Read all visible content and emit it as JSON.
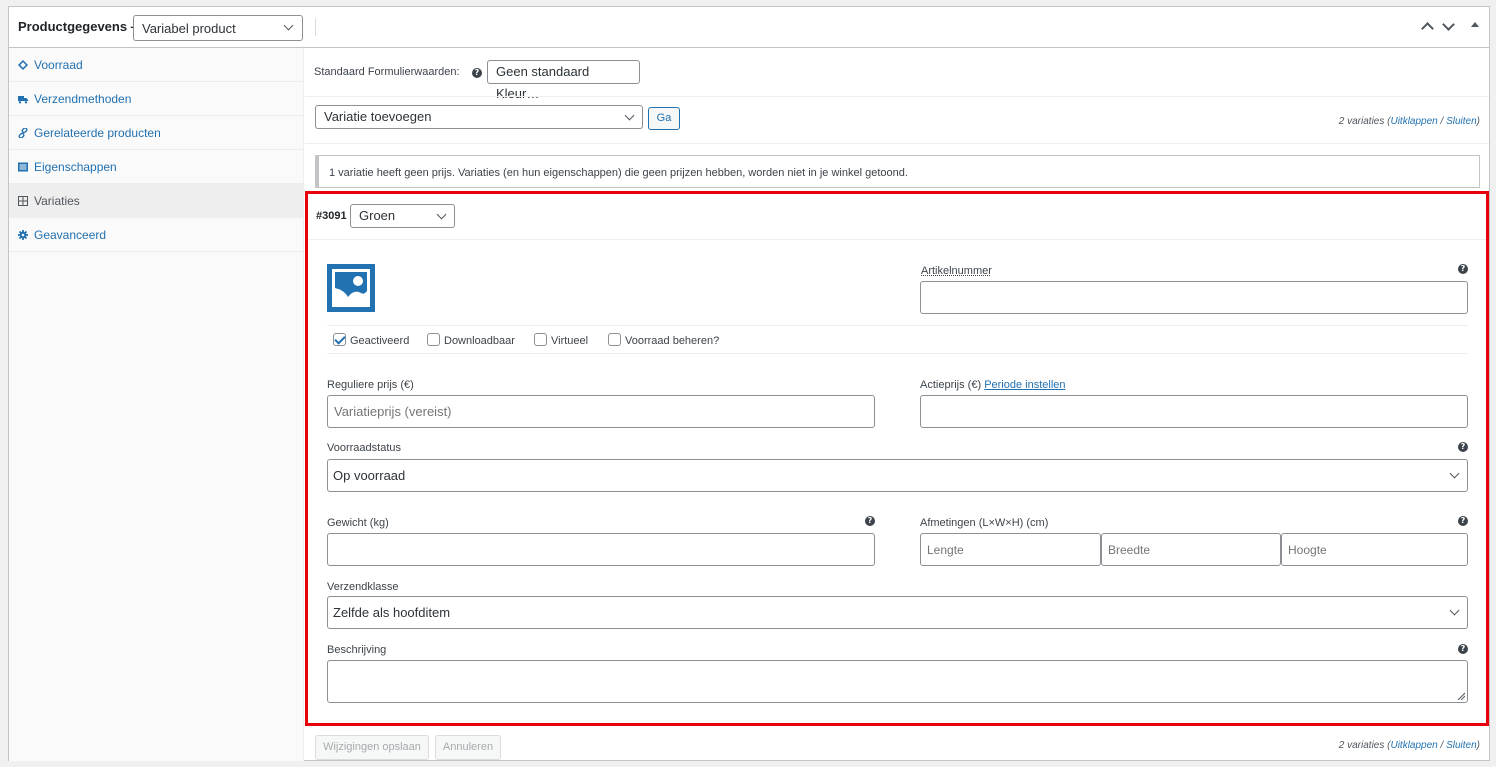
{
  "header": {
    "title": "Productgegevens —",
    "product_type": "Variabel product"
  },
  "sidebar": {
    "items": [
      {
        "label": "Voorraad",
        "icon": "inventory-icon"
      },
      {
        "label": "Verzendmethoden",
        "icon": "truck-icon"
      },
      {
        "label": "Gerelateerde producten",
        "icon": "link-icon"
      },
      {
        "label": "Eigenschappen",
        "icon": "list-icon"
      },
      {
        "label": "Variaties",
        "icon": "grid-icon"
      },
      {
        "label": "Geavanceerd",
        "icon": "gear-icon"
      }
    ]
  },
  "defaults": {
    "label": "Standaard Formulierwaarden:",
    "value": "Geen standaard Kleur…"
  },
  "add_variation": {
    "select": "Variatie toevoegen",
    "go_button": "Ga",
    "count_text": "2 variaties",
    "expand": "Uitklappen",
    "separator": " / ",
    "close": "Sluiten"
  },
  "notice": "1 variatie heeft geen prijs. Variaties (en hun eigenschappen) die geen prijzen hebben, worden niet in je winkel getoond.",
  "variation": {
    "id": "#3091",
    "color": "Groen",
    "sku_label": "Artikelnummer",
    "sku_value": "",
    "checkboxes": [
      {
        "label": "Geactiveerd",
        "checked": true
      },
      {
        "label": "Downloadbaar",
        "checked": false
      },
      {
        "label": "Virtueel",
        "checked": false
      },
      {
        "label": "Voorraad beheren?",
        "checked": false
      }
    ],
    "regular_price_label": "Reguliere prijs (€)",
    "regular_price_placeholder": "Variatieprijs (vereist)",
    "sale_price_label": "Actieprijs (€)",
    "sale_schedule_link": "Periode instellen",
    "stock_status_label": "Voorraadstatus",
    "stock_status_value": "Op voorraad",
    "weight_label": "Gewicht (kg)",
    "dimensions_label": "Afmetingen (L×W×H) (cm)",
    "length_placeholder": "Lengte",
    "width_placeholder": "Breedte",
    "height_placeholder": "Hoogte",
    "shipping_class_label": "Verzendklasse",
    "shipping_class_value": "Zelfde als hoofditem",
    "description_label": "Beschrijving"
  },
  "footer": {
    "save_button": "Wijzigingen opslaan",
    "cancel_button": "Annuleren"
  },
  "colors": {
    "highlight_border": "#e8000b",
    "link": "#2271b1"
  }
}
